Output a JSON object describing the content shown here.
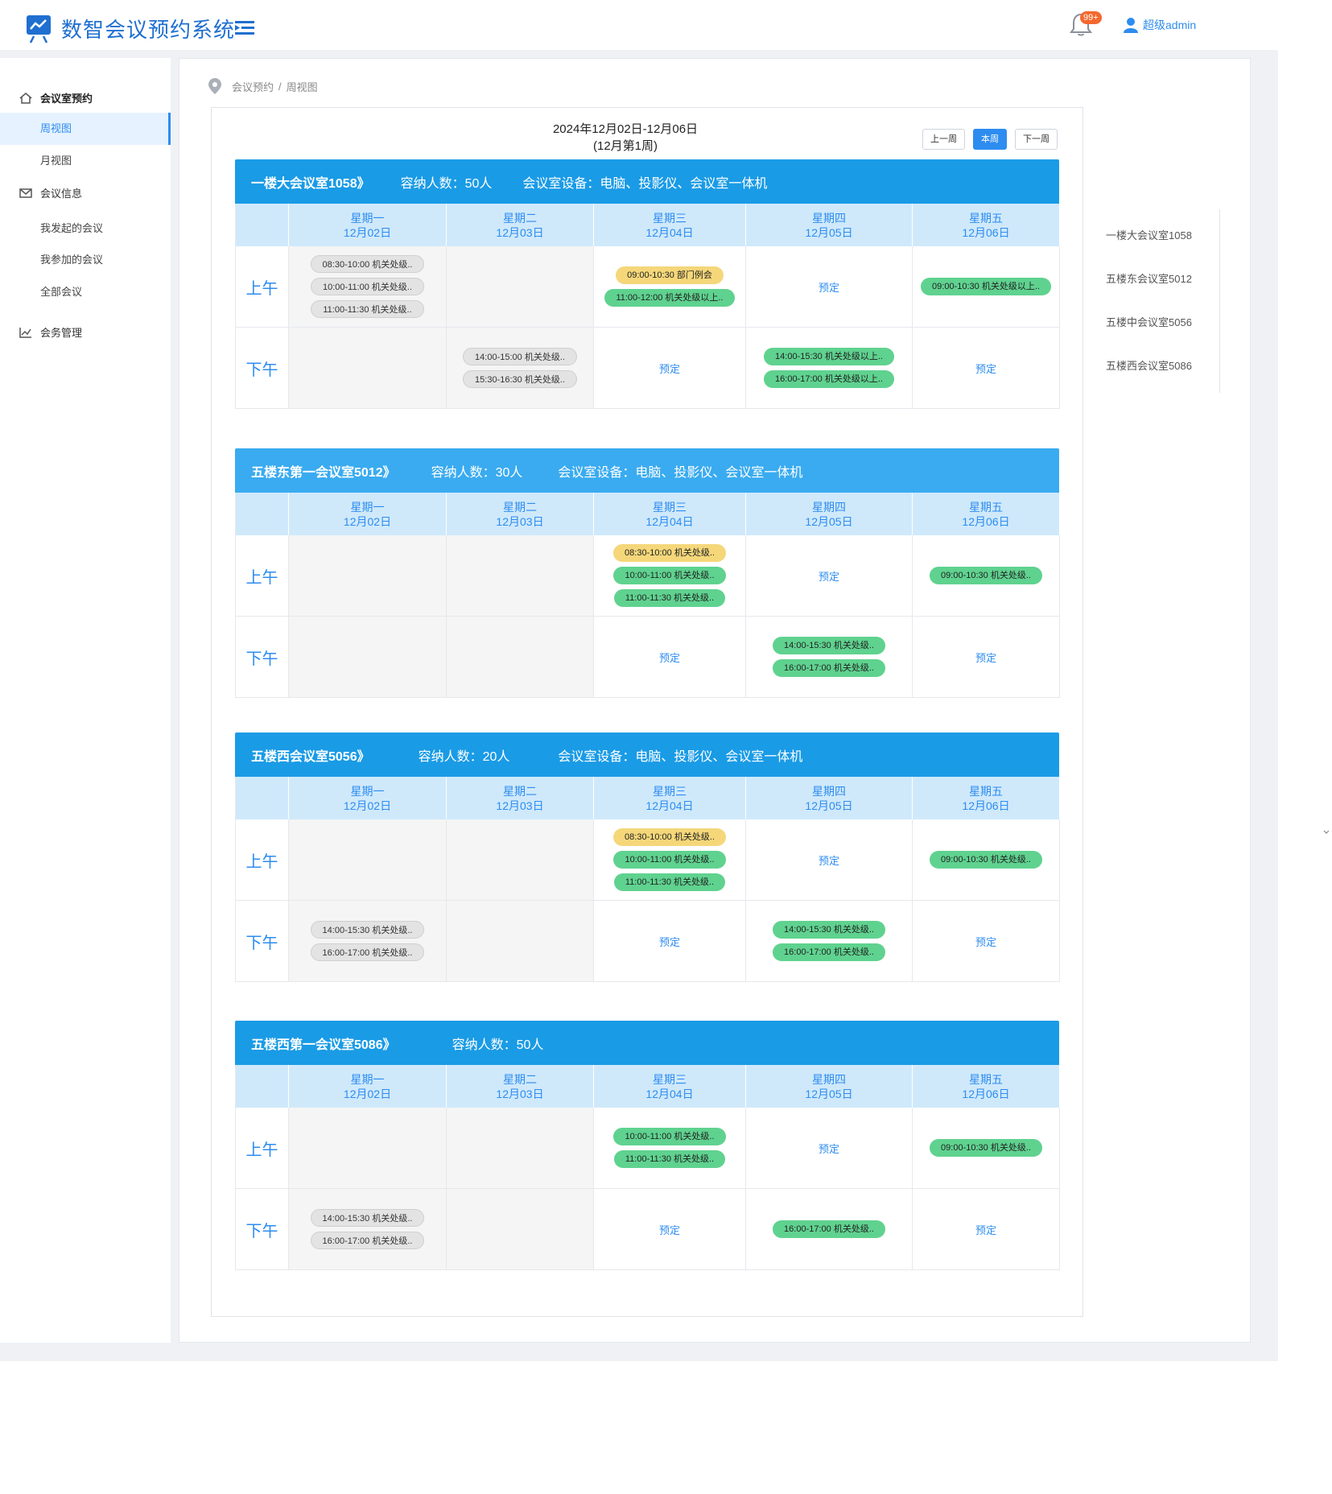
{
  "app": {
    "title": "数智会议预约系统"
  },
  "header": {
    "badge": "99+",
    "user": "超级admin"
  },
  "sidebar": {
    "groups": [
      {
        "label": "会议室预约",
        "icon": "home-icon"
      },
      {
        "label": "会议信息",
        "icon": "mail-icon"
      },
      {
        "label": "会务管理",
        "icon": "chart-icon"
      }
    ],
    "items": [
      "周视图",
      "月视图",
      "我发起的会议",
      "我参加的会议",
      "全部会议"
    ]
  },
  "breadcrumb": {
    "root": "会议预约",
    "sep": "/",
    "current": "周视图"
  },
  "week": {
    "range": "2024年12月02日-12月06日",
    "label": "(12月第1周)",
    "prev": "上一周",
    "current": "本周",
    "next": "下一周"
  },
  "labels": {
    "am": "上午",
    "pm": "下午",
    "book": "预定"
  },
  "days": [
    {
      "name": "星期一",
      "date": "12月02日"
    },
    {
      "name": "星期二",
      "date": "12月03日"
    },
    {
      "name": "星期三",
      "date": "12月04日"
    },
    {
      "name": "星期四",
      "date": "12月05日"
    },
    {
      "name": "星期五",
      "date": "12月06日"
    }
  ],
  "rooms": [
    {
      "name": "一楼大会议室1058》",
      "capacity": "容纳人数：50人",
      "equipment": "会议室设备：电脑、投影仪、会议室一体机",
      "color": "#1a9be6",
      "am": [
        {
          "past": true,
          "events": [
            {
              "text": "08:30-10:00 机关处级..",
              "color": "gray"
            },
            {
              "text": "10:00-11:00 机关处级..",
              "color": "gray"
            },
            {
              "text": "11:00-11:30 机关处级..",
              "color": "gray"
            }
          ]
        },
        {
          "past": true,
          "events": []
        },
        {
          "past": false,
          "events": [
            {
              "text": "09:00-10:30 部门例会",
              "color": "yellow"
            },
            {
              "text": "11:00-12:00 机关处级以上..",
              "color": "green"
            }
          ]
        },
        {
          "past": false,
          "book": true,
          "events": []
        },
        {
          "past": false,
          "events": [
            {
              "text": "09:00-10:30 机关处级以上..",
              "color": "green"
            }
          ]
        }
      ],
      "pm": [
        {
          "past": true,
          "events": []
        },
        {
          "past": true,
          "events": [
            {
              "text": "14:00-15:00 机关处级..",
              "color": "gray"
            },
            {
              "text": "15:30-16:30 机关处级..",
              "color": "gray"
            }
          ]
        },
        {
          "past": false,
          "book": true,
          "events": []
        },
        {
          "past": false,
          "events": [
            {
              "text": "14:00-15:30 机关处级以上..",
              "color": "green"
            },
            {
              "text": "16:00-17:00 机关处级以上..",
              "color": "green"
            }
          ]
        },
        {
          "past": false,
          "book": true,
          "events": []
        }
      ]
    },
    {
      "name": "五楼东第一会议室5012》",
      "capacity": "容纳人数：30人",
      "equipment": "会议室设备：电脑、投影仪、会议室一体机",
      "color": "#3aabf0",
      "am": [
        {
          "past": true,
          "events": []
        },
        {
          "past": true,
          "events": []
        },
        {
          "past": false,
          "events": [
            {
              "text": "08:30-10:00 机关处级..",
              "color": "yellow"
            },
            {
              "text": "10:00-11:00 机关处级..",
              "color": "green"
            },
            {
              "text": "11:00-11:30 机关处级..",
              "color": "green"
            }
          ]
        },
        {
          "past": false,
          "book": true,
          "events": []
        },
        {
          "past": false,
          "events": [
            {
              "text": "09:00-10:30 机关处级..",
              "color": "green"
            }
          ]
        }
      ],
      "pm": [
        {
          "past": true,
          "events": []
        },
        {
          "past": true,
          "events": []
        },
        {
          "past": false,
          "book": true,
          "events": []
        },
        {
          "past": false,
          "events": [
            {
              "text": "14:00-15:30 机关处级..",
              "color": "green"
            },
            {
              "text": "16:00-17:00 机关处级..",
              "color": "green"
            }
          ]
        },
        {
          "past": false,
          "book": true,
          "events": []
        }
      ]
    },
    {
      "name": "五楼西会议室5056》",
      "capacity": "容纳人数：20人",
      "equipment": "会议室设备：电脑、投影仪、会议室一体机",
      "color": "#1a9be6",
      "am": [
        {
          "past": true,
          "events": []
        },
        {
          "past": true,
          "events": []
        },
        {
          "past": false,
          "events": [
            {
              "text": "08:30-10:00 机关处级..",
              "color": "yellow"
            },
            {
              "text": "10:00-11:00 机关处级..",
              "color": "green"
            },
            {
              "text": "11:00-11:30 机关处级..",
              "color": "green"
            }
          ]
        },
        {
          "past": false,
          "book": true,
          "events": []
        },
        {
          "past": false,
          "events": [
            {
              "text": "09:00-10:30 机关处级..",
              "color": "green"
            }
          ]
        }
      ],
      "pm": [
        {
          "past": true,
          "events": [
            {
              "text": "14:00-15:30 机关处级..",
              "color": "gray"
            },
            {
              "text": "16:00-17:00 机关处级..",
              "color": "gray"
            }
          ]
        },
        {
          "past": true,
          "events": []
        },
        {
          "past": false,
          "book": true,
          "events": []
        },
        {
          "past": false,
          "events": [
            {
              "text": "14:00-15:30 机关处级..",
              "color": "green"
            },
            {
              "text": "16:00-17:00 机关处级..",
              "color": "green"
            }
          ]
        },
        {
          "past": false,
          "book": true,
          "events": []
        }
      ]
    },
    {
      "name": "五楼西第一会议室5086》",
      "capacity": "容纳人数：50人",
      "equipment": "",
      "color": "#1a9be6",
      "am": [
        {
          "past": true,
          "events": []
        },
        {
          "past": true,
          "events": []
        },
        {
          "past": false,
          "events": [
            {
              "text": "10:00-11:00 机关处级..",
              "color": "green"
            },
            {
              "text": "11:00-11:30 机关处级..",
              "color": "green"
            }
          ]
        },
        {
          "past": false,
          "book": true,
          "events": []
        },
        {
          "past": false,
          "events": [
            {
              "text": "09:00-10:30 机关处级..",
              "color": "green"
            }
          ]
        }
      ],
      "pm": [
        {
          "past": true,
          "events": [
            {
              "text": "14:00-15:30 机关处级..",
              "color": "gray"
            },
            {
              "text": "16:00-17:00 机关处级..",
              "color": "gray"
            }
          ]
        },
        {
          "past": true,
          "events": []
        },
        {
          "past": false,
          "book": true,
          "events": []
        },
        {
          "past": false,
          "events": [
            {
              "text": "16:00-17:00 机关处级..",
              "color": "green"
            }
          ]
        },
        {
          "past": false,
          "book": true,
          "events": []
        }
      ]
    }
  ],
  "roomNav": [
    "一楼大会议室1058",
    "五楼东会议室5012",
    "五楼中会议室5056",
    "五楼西会议室5086"
  ]
}
